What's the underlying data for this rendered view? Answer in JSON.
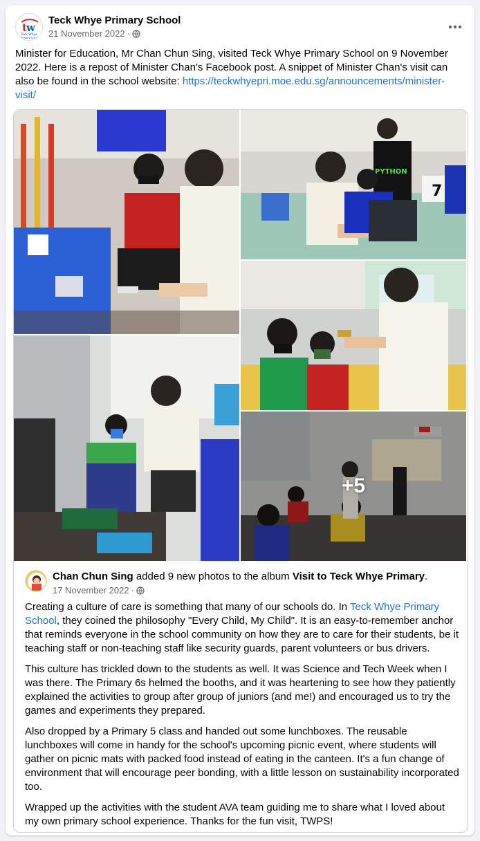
{
  "post": {
    "page_name": "Teck Whye Primary School",
    "logo_text": "Teck Whye",
    "logo_sub": "Primary School",
    "date": "21 November 2022",
    "separator": "·",
    "caption": "Minister for Education, Mr Chan Chun Sing, visited Teck Whye Primary School on 9 November 2022. Here is a repost of Minister Chan's Facebook post. A snippet of Minister Chan's visit can also be found in the school website:",
    "caption_link": "https://teckwhyepri.moe.edu.sg/announcements/minister-visit/",
    "more_icon": "more-options-icon"
  },
  "album": {
    "more_count": "+5"
  },
  "shared": {
    "author": "Chan Chun Sing",
    "action": "added 9 new photos to the album",
    "album_name": "Visit to Teck Whye Primary",
    "end": ".",
    "date": "17 November 2022",
    "separator": "·",
    "p1_before": "Creating a culture of care is something that many of our schools do. In",
    "p1_link": "Teck Whye Primary School",
    "p1_after": ", they coined the philosophy \"Every Child, My Child\". It is an easy-to-remember anchor that reminds everyone in the school community on how they are to care for their students, be it teaching staff or non-teaching staff like security guards, parent volunteers or bus drivers.",
    "p2": "This culture has trickled down to the students as well. It was Science and Tech Week when I was there. The Primary 6s helmed the booths, and it was heartening to see how they patiently explained the activities to group after group of juniors (and me!) and encouraged us to try the games and experiments they prepared.",
    "p3": "Also dropped by a Primary 5 class and handed out some lunchboxes. The reusable lunchboxes will come in handy for the school's upcoming picnic event, where students will gather on picnic mats with packed food instead of eating in the canteen. It's a fun change of environment that will encourage peer bonding, with a little lesson on sustainability incorporated too.",
    "p4": "Wrapped up the activities with the student AVA team guiding me to share what I loved about my own primary school experience. Thanks for the fun visit, TWPS!"
  },
  "photo_labels": {
    "card_number": "7",
    "shirt_text": "PYTHON"
  },
  "colors": {
    "link": "#216fdb",
    "meta": "#65676b",
    "text": "#050505"
  }
}
